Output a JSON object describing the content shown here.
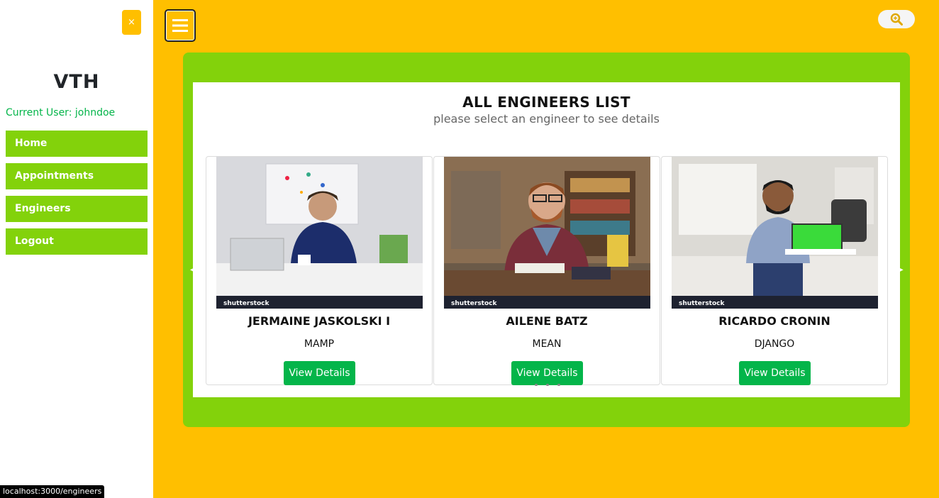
{
  "sidebar": {
    "close_label": "×",
    "brand": "VTH",
    "current_user": "Current User: johndoe",
    "items": [
      {
        "label": "Home"
      },
      {
        "label": "Appointments"
      },
      {
        "label": "Engineers"
      },
      {
        "label": "Logout"
      }
    ]
  },
  "topbar": {
    "menu_icon": "hamburger-icon",
    "search_icon": "search-icon"
  },
  "panel": {
    "title": "ALL ENGINEERS LIST",
    "subtitle": "please select an engineer to see details"
  },
  "engineers": [
    {
      "name": "JERMAINE JASKOLSKI I",
      "skill": "MAMP",
      "button": "View Details",
      "watermark": "shutterstock"
    },
    {
      "name": "AILENE BATZ",
      "skill": "MEAN",
      "button": "View Details",
      "watermark": "shutterstock"
    },
    {
      "name": "RICARDO CRONIN",
      "skill": "DJANGO",
      "button": "View Details",
      "watermark": "shutterstock"
    }
  ],
  "status_bar": {
    "url": "localhost:3000/engineers"
  },
  "colors": {
    "background": "#ffbf00",
    "accent_green": "#83d20b",
    "button_green": "#04b54a",
    "user_text": "#04b54a"
  }
}
